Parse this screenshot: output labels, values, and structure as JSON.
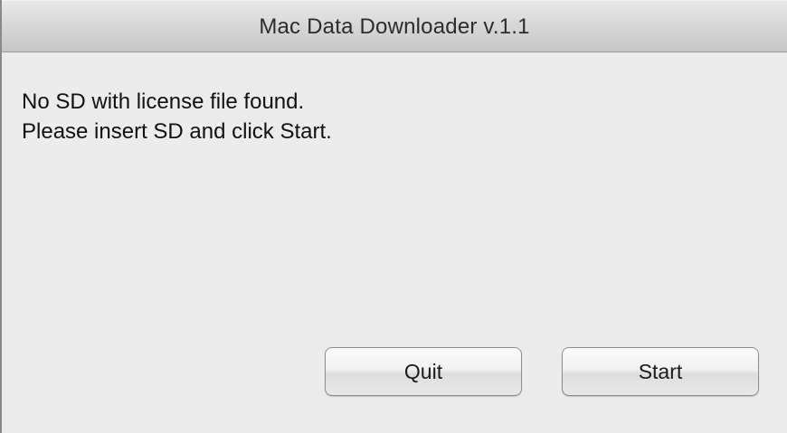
{
  "window": {
    "title": "Mac Data Downloader v.1.1"
  },
  "message": {
    "line1": "No SD with license file found.",
    "line2": "Please insert SD and click Start."
  },
  "buttons": {
    "quit_label": "Quit",
    "start_label": "Start"
  }
}
